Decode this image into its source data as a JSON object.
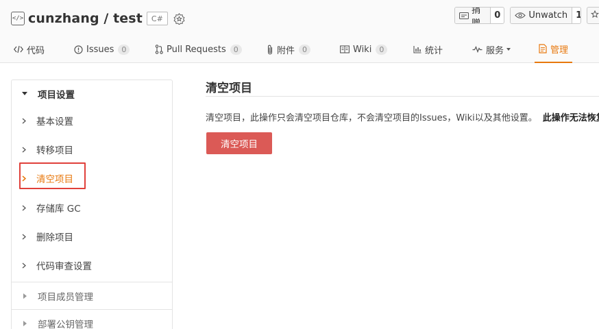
{
  "repo": {
    "name": "cunzhang / test",
    "language": "C#"
  },
  "actions": {
    "donate_label": "捐赠",
    "donate_count": "0",
    "watch_label": "Unwatch",
    "watch_count": "1"
  },
  "nav": {
    "code": "代码",
    "issues": "Issues",
    "issues_count": "0",
    "pulls": "Pull Requests",
    "pulls_count": "0",
    "attachments": "附件",
    "attachments_count": "0",
    "wiki": "Wiki",
    "wiki_count": "0",
    "stats": "统计",
    "services": "服务",
    "manage": "管理"
  },
  "sidebar": {
    "section_title": "项目设置",
    "items": [
      {
        "label": "基本设置"
      },
      {
        "label": "转移项目"
      },
      {
        "label": "清空项目"
      },
      {
        "label": "存储库 GC"
      },
      {
        "label": "删除项目"
      },
      {
        "label": "代码审查设置"
      }
    ],
    "sub_sections": [
      {
        "label": "项目成员管理"
      },
      {
        "label": "部署公钥管理"
      }
    ]
  },
  "main": {
    "title": "清空项目",
    "description": "清空项目，此操作只会清空项目仓库，不会清空项目的Issues，Wiki以及其他设置。",
    "warning": "此操作无法恢复",
    "button_label": "清空项目"
  },
  "colors": {
    "accent": "#e8780d",
    "danger": "#db5a56",
    "highlight": "#e0403a"
  }
}
